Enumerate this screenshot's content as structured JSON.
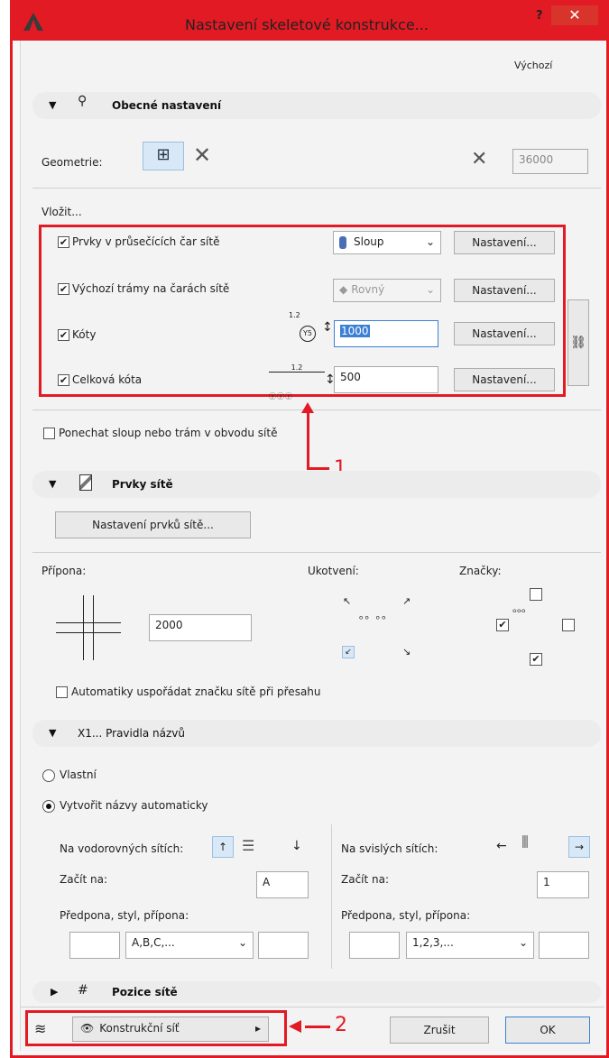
{
  "window": {
    "title": "Nastavení skeletové konstrukce...",
    "help": "?",
    "close": "✕",
    "default_label": "Výchozí"
  },
  "general": {
    "header": "Obecné nastavení",
    "geometry_label": "Geometrie:",
    "geometry_value": "36000",
    "insert_label": "Vložit...",
    "rows": [
      {
        "label": "Prvky v průsečících čar sítě",
        "checked": true,
        "selector": "Sloup",
        "button": "Nastavení..."
      },
      {
        "label": "Výchozí trámy na čarách sítě",
        "checked": true,
        "selector": "Rovný",
        "button": "Nastavení..."
      },
      {
        "label": "Kóty",
        "checked": true,
        "value": "1000",
        "button": "Nastavení..."
      },
      {
        "label": "Celková kóta",
        "checked": true,
        "value": "500",
        "button": "Nastavení..."
      }
    ],
    "keep_label": "Ponechat sloup nebo trám v obvodu sítě",
    "dim_a": "1.2",
    "dim_b": "Y5"
  },
  "grid": {
    "header": "Prvky sítě",
    "button": "Nastavení prvků sítě...",
    "suffix_label": "Přípona:",
    "suffix_value": "2000",
    "anchor_label": "Ukotvení:",
    "marks_label": "Značky:",
    "auto_label": "Automatiky uspořádat značku sítě při přesahu"
  },
  "naming": {
    "header": "X1... Pravidla názvů",
    "own_label": "Vlastní",
    "auto_label": "Vytvořit názvy automaticky",
    "horizontal_label": "Na vodorovných sítích:",
    "vertical_label": "Na svislých sítích:",
    "start_label_h": "Začít na:",
    "start_value_h": "A",
    "start_label_v": "Začít na:",
    "start_value_v": "1",
    "prefix_label_h": "Předpona, styl, přípona:",
    "prefix_label_v": "Předpona, styl, přípona:",
    "style_h": "A,B,C,...",
    "style_v": "1,2,3,..."
  },
  "position": {
    "header": "Pozice sítě"
  },
  "footer": {
    "layer": "Konstrukční síť",
    "cancel": "Zrušit",
    "ok": "OK"
  },
  "callouts": {
    "one": "1",
    "two": "2"
  },
  "colors": {
    "accent": "#e21a24",
    "selected_button": "#d8e8f7"
  }
}
